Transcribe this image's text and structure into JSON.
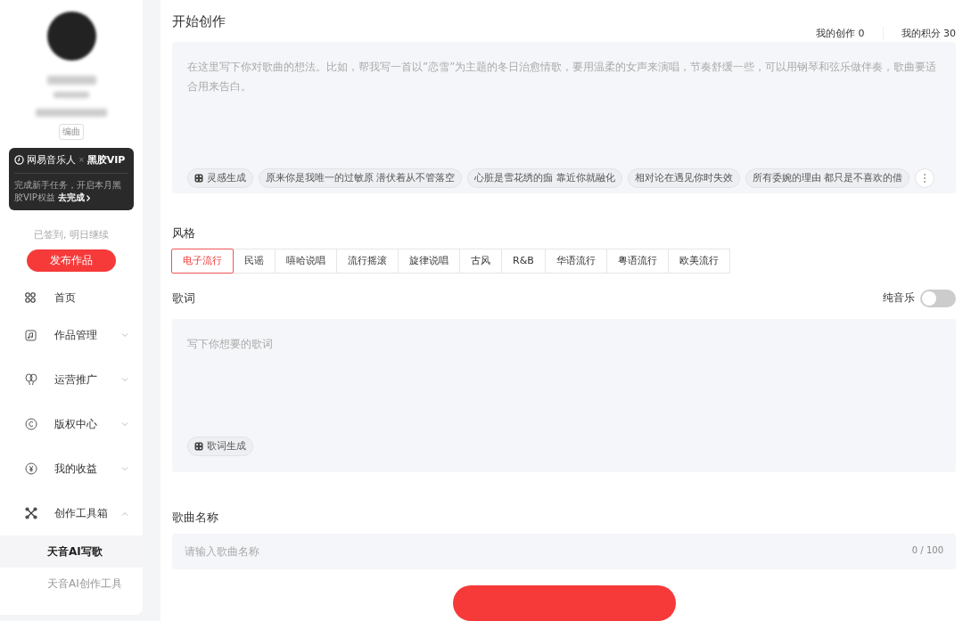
{
  "sidebar": {
    "profile_tag": "编曲",
    "vip_card": {
      "brand": "网易音乐人",
      "separator": "×",
      "partner": "黑胶VIP",
      "text": "完成新手任务，开启本月黑胶VIP权益",
      "link": "去完成"
    },
    "checkin": "已签到, 明日继续",
    "publish_button": "发布作品",
    "nav": [
      {
        "label": "首页",
        "kind": "plain"
      },
      {
        "label": "作品管理",
        "kind": "group",
        "expanded": false
      },
      {
        "label": "运营推广",
        "kind": "group",
        "expanded": false
      },
      {
        "label": "版权中心",
        "kind": "group",
        "expanded": false
      },
      {
        "label": "我的收益",
        "kind": "group",
        "expanded": false
      },
      {
        "label": "创作工具箱",
        "kind": "group",
        "expanded": true,
        "children": [
          {
            "label": "天音AI写歌",
            "selected": true
          },
          {
            "label": "天音AI创作工具",
            "selected": false
          }
        ]
      }
    ]
  },
  "main": {
    "title": "开始创作",
    "stats": [
      "我的创作 0",
      "我的积分 30"
    ],
    "idea": {
      "placeholder": "在这里写下你对歌曲的想法。比如，帮我写一首以”恋雪”为主题的冬日治愈情歌，要用温柔的女声来演唱，节奏舒缓一些，可以用钢琴和弦乐做伴奏，歌曲要适合用来告白。",
      "inspire_button": "灵感生成",
      "suggestions": [
        "原来你是我唯一的过敏原 潜伏着从不管落空",
        "心脏是雪花绣的痂 靠近你就融化",
        "相对论在遇见你时失效",
        "所有委婉的理由 都只是不喜欢的借"
      ]
    },
    "style": {
      "label": "风格",
      "options": [
        {
          "label": "电子流行",
          "selected": true
        },
        {
          "label": "民谣",
          "selected": false
        },
        {
          "label": "嘻哈说唱",
          "selected": false
        },
        {
          "label": "流行摇滚",
          "selected": false
        },
        {
          "label": "旋律说唱",
          "selected": false
        },
        {
          "label": "古风",
          "selected": false
        },
        {
          "label": "R&B",
          "selected": false
        },
        {
          "label": "华语流行",
          "selected": false
        },
        {
          "label": "粤语流行",
          "selected": false
        },
        {
          "label": "欧美流行",
          "selected": false
        }
      ]
    },
    "lyrics": {
      "label": "歌词",
      "instrumental_label": "纯音乐",
      "instrumental_on": false,
      "placeholder": "写下你想要的歌词",
      "generate_button": "歌词生成"
    },
    "song_name": {
      "label": "歌曲名称",
      "placeholder": "请输入歌曲名称",
      "counter": "0 / 100"
    }
  }
}
